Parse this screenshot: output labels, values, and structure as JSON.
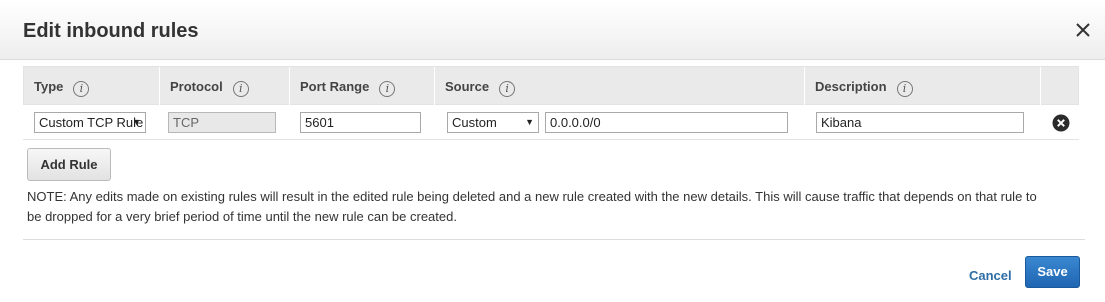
{
  "dialog": {
    "title": "Edit inbound rules",
    "close_label": "×"
  },
  "table": {
    "headers": [
      "Type",
      "Protocol",
      "Port Range",
      "Source",
      "Description"
    ],
    "info_glyph": "i",
    "rows": [
      {
        "type": "Custom TCP Rule",
        "protocol": "TCP",
        "port_range": "5601",
        "source_type": "Custom",
        "source_value": "0.0.0.0/0",
        "description": "Kibana"
      }
    ]
  },
  "actions": {
    "add_rule_label": "Add Rule",
    "cancel_label": "Cancel",
    "save_label": "Save"
  },
  "note": "NOTE: Any edits made on existing rules will result in the edited rule being deleted and a new rule created with the new details. This will cause traffic that depends on that rule to be dropped for a very brief period of time until the new rule can be created.",
  "colors": {
    "accent": "#2e6da4",
    "save_button": "#2a78c5"
  },
  "icons": {
    "close": "close-icon",
    "remove_rule": "remove-circle-icon",
    "info": "info-icon",
    "dropdown": "chevron-down-icon"
  }
}
